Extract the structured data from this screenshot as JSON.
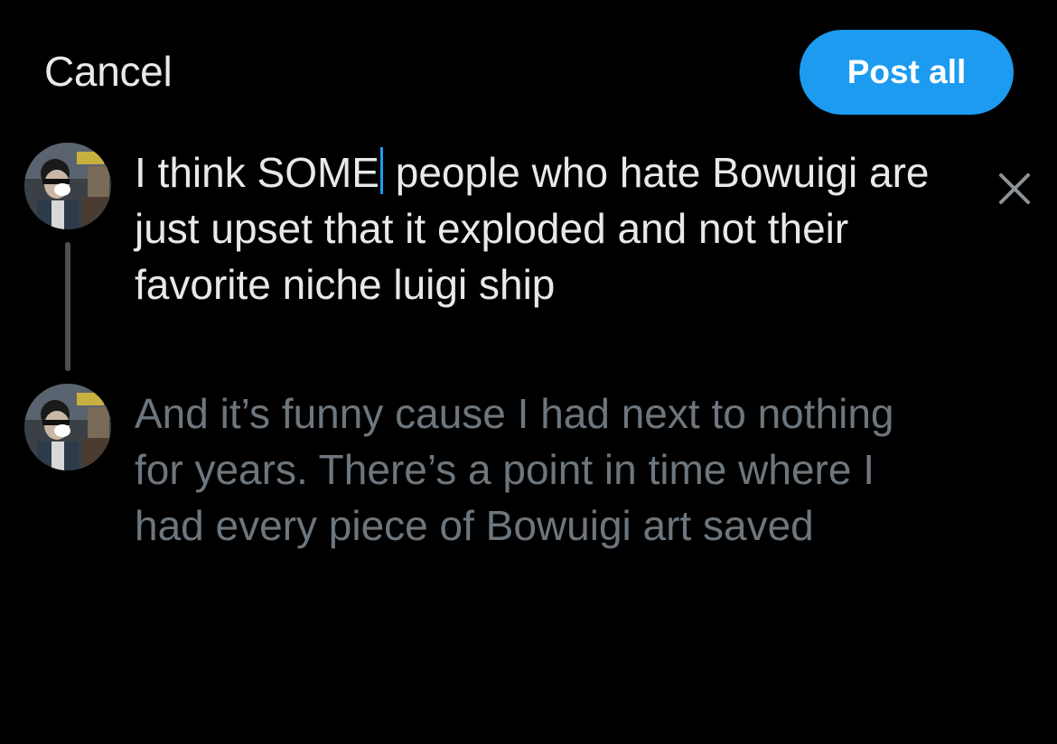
{
  "header": {
    "cancel_label": "Cancel",
    "post_all_label": "Post all"
  },
  "thread": [
    {
      "text_before_caret": "I think SOME",
      "text_after_caret": " people who hate Bowuigi are just upset that it exploded and not their favorite niche luigi ship",
      "active": true
    },
    {
      "text": "And it’s funny cause I had next to nothing for years. There’s a point in time where I had every piece of Bowuigi art saved",
      "active": false
    }
  ],
  "icons": {
    "remove": "close-icon",
    "avatar": "user-avatar"
  },
  "colors": {
    "background": "#000000",
    "accent": "#1d9bf0",
    "primary_text": "#e7e9ea",
    "secondary_text": "#6e767d",
    "thread_line": "#4a4f54"
  }
}
